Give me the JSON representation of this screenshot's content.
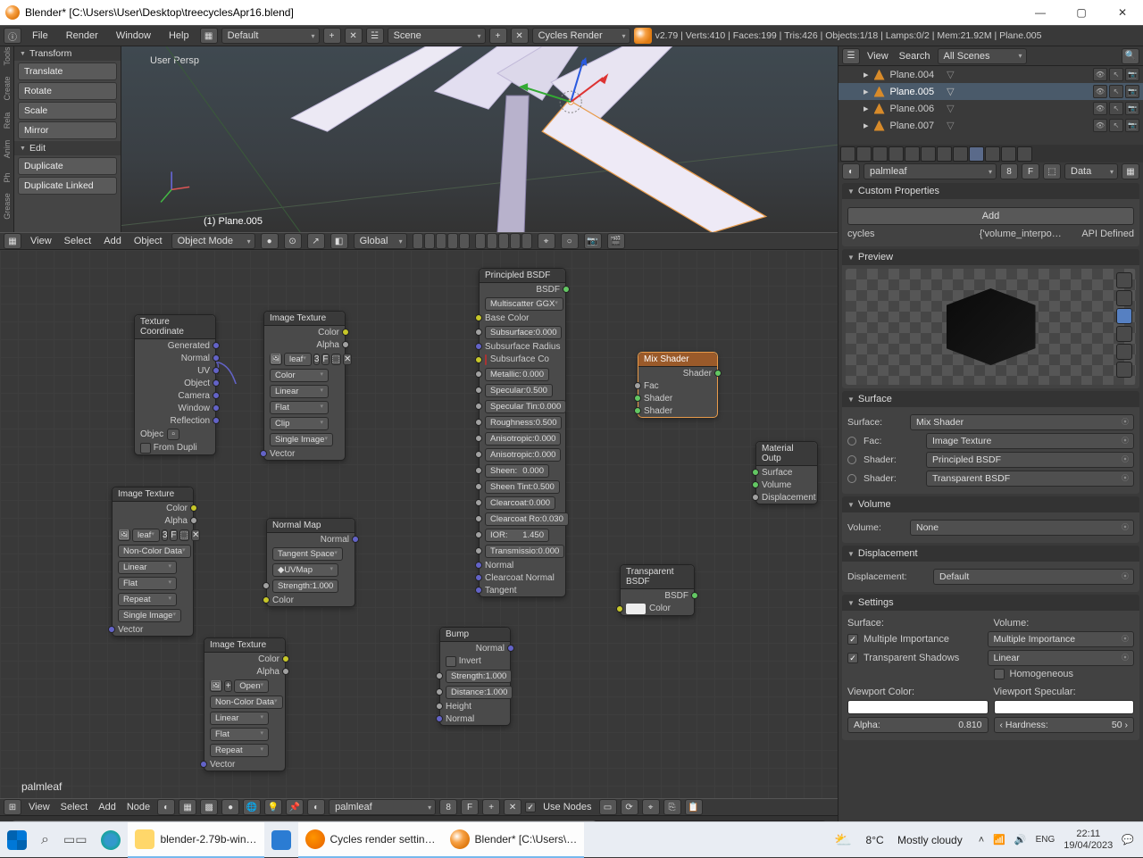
{
  "window": {
    "title": "Blender* [C:\\Users\\User\\Desktop\\treecyclesApr16.blend]"
  },
  "menubar": {
    "items": [
      "File",
      "Render",
      "Window",
      "Help"
    ],
    "layout": "Default",
    "scene": "Scene",
    "engine": "Cycles Render",
    "stats": "v2.79 | Verts:410 | Faces:199 | Tris:426 | Objects:1/18 | Lamps:0/2 | Mem:21.92M | Plane.005"
  },
  "side_tabs": [
    "Tools",
    "Create",
    "Rela",
    "Anim",
    "Ph",
    "Grease"
  ],
  "transform": {
    "title": "Transform",
    "btns": [
      "Translate",
      "Rotate",
      "Scale",
      "Mirror"
    ]
  },
  "edit": {
    "title": "Edit",
    "btns": [
      "Duplicate",
      "Duplicate Linked"
    ]
  },
  "viewport": {
    "persp": "User Persp",
    "active": "(1) Plane.005",
    "header_menus": [
      "View",
      "Select",
      "Add",
      "Object"
    ],
    "mode": "Object Mode",
    "orientation": "Global"
  },
  "outliner": {
    "view_label": "View",
    "search_label": "Search",
    "scenes": "All Scenes",
    "items": [
      {
        "name": "Plane.004",
        "sel": false
      },
      {
        "name": "Plane.005",
        "sel": true
      },
      {
        "name": "Plane.006",
        "sel": false
      },
      {
        "name": "Plane.007",
        "sel": false
      }
    ]
  },
  "nodes": {
    "material": "palmleaf",
    "texcoord": {
      "title": "Texture Coordinate",
      "outs": [
        "Generated",
        "Normal",
        "UV",
        "Object",
        "Camera",
        "Window",
        "Reflection"
      ],
      "object": "Objec",
      "dupli": "From Dupli"
    },
    "imgA": {
      "title": "Image Texture",
      "outs": [
        "Color",
        "Alpha"
      ],
      "file": "leaf",
      "users": "3",
      "colorspace": "Color",
      "interp": "Linear",
      "proj": "Flat",
      "ext": "Clip",
      "single": "Single Image",
      "vec": "Vector"
    },
    "imgB": {
      "title": "Image Texture",
      "outs": [
        "Color",
        "Alpha"
      ],
      "file": "leaf",
      "users": "3",
      "colorspace": "Non-Color Data",
      "interp": "Linear",
      "proj": "Flat",
      "ext": "Repeat",
      "single": "Single Image",
      "vec": "Vector"
    },
    "imgC": {
      "title": "Image Texture",
      "outs": [
        "Color",
        "Alpha"
      ],
      "open": "Open",
      "colorspace": "Non-Color Data",
      "interp": "Linear",
      "proj": "Flat",
      "ext": "Repeat",
      "vec": "Vector"
    },
    "normal": {
      "title": "Normal Map",
      "out": "Normal",
      "space": "Tangent Space",
      "uvmap": "UVMap",
      "strength_l": "Strength:",
      "strength_v": "1.000",
      "color": "Color"
    },
    "bump": {
      "title": "Bump",
      "out": "Normal",
      "invert": "Invert",
      "strength_l": "Strength:",
      "strength_v": "1.000",
      "distance_l": "Distance:",
      "distance_v": "1.000",
      "height": "Height",
      "normal": "Normal"
    },
    "principled": {
      "title": "Principled BSDF",
      "out": "BSDF",
      "distribution": "Multiscatter GGX",
      "rows": [
        [
          "Base Color",
          ""
        ],
        [
          "Subsurface:",
          "0.000"
        ],
        [
          "Subsurface Radius",
          ""
        ],
        [
          "Subsurface Co",
          ""
        ],
        [
          "Metallic:",
          "0.000"
        ],
        [
          "Specular:",
          "0.500"
        ],
        [
          "Specular Tin:",
          "0.000"
        ],
        [
          "Roughness:",
          "0.500"
        ],
        [
          "Anisotropic:",
          "0.000"
        ],
        [
          "Anisotropic:",
          "0.000"
        ],
        [
          "Sheen:",
          "0.000"
        ],
        [
          "Sheen Tint:",
          "0.500"
        ],
        [
          "Clearcoat:",
          "0.000"
        ],
        [
          "Clearcoat Ro:",
          "0.030"
        ],
        [
          "IOR:",
          "1.450"
        ],
        [
          "Transmissio:",
          "0.000"
        ]
      ],
      "bottom": [
        "Normal",
        "Clearcoat Normal",
        "Tangent"
      ]
    },
    "trans": {
      "title": "Transparent BSDF",
      "out": "BSDF",
      "color": "Color"
    },
    "mix": {
      "title": "Mix Shader",
      "out": "Shader",
      "fac": "Fac",
      "sh1": "Shader",
      "sh2": "Shader"
    },
    "matout": {
      "title": "Material Outp",
      "ins": [
        "Surface",
        "Volume",
        "Displacement"
      ]
    }
  },
  "ne_header": {
    "menus": [
      "View",
      "Select",
      "Add",
      "Node"
    ],
    "mat": "palmleaf",
    "users": "8",
    "use_nodes": "Use Nodes"
  },
  "props": {
    "datablock_name": "palmleaf",
    "datablock_users": "8",
    "datablock_type": "Data",
    "custom": {
      "title": "Custom Properties",
      "add": "Add",
      "key": "cycles",
      "val": "{'volume_interpo…",
      "api": "API Defined"
    },
    "preview": {
      "title": "Preview"
    },
    "surface": {
      "title": "Surface",
      "surface_l": "Surface:",
      "surface_v": "Mix Shader",
      "fac_l": "Fac:",
      "fac_v": "Image Texture",
      "sh1_l": "Shader:",
      "sh1_v": "Principled BSDF",
      "sh2_l": "Shader:",
      "sh2_v": "Transparent BSDF"
    },
    "volume": {
      "title": "Volume",
      "label": "Volume:",
      "value": "None"
    },
    "displacement": {
      "title": "Displacement",
      "label": "Displacement:",
      "value": "Default"
    },
    "settings": {
      "title": "Settings",
      "surf_l": "Surface:",
      "vol_l": "Volume:",
      "mis": "Multiple Importance",
      "ts": "Transparent Shadows",
      "mis2": "Multiple Importance",
      "lin": "Linear",
      "hom": "Homogeneous",
      "vpcol": "Viewport Color:",
      "vpspec": "Viewport Specular:",
      "alpha_l": "Alpha:",
      "alpha_v": "0.810",
      "hard_l": "Hardness:",
      "hard_v": "50"
    }
  },
  "taskbar": {
    "items": [
      "blender-2.79b-win…",
      "",
      "Cycles render settin…",
      "Blender* [C:\\Users\\…"
    ],
    "weather_t": "8°C",
    "weather_d": "Mostly cloudy",
    "time": "22:11",
    "date": "19/04/2023"
  }
}
